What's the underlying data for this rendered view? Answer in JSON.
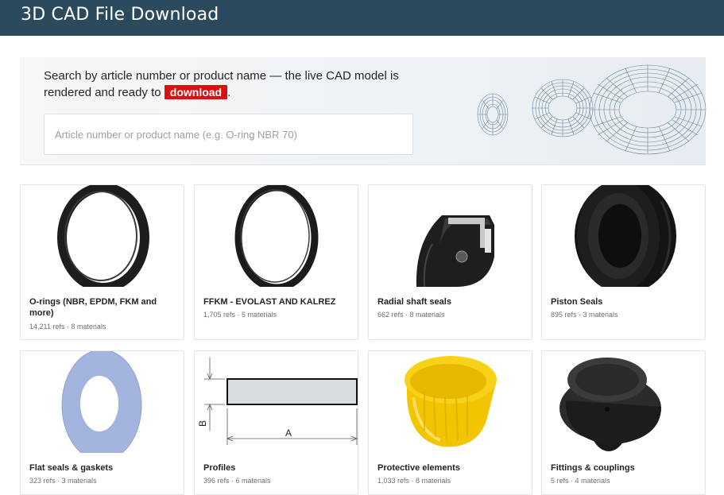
{
  "header": {
    "title": "3D CAD File Download"
  },
  "hero": {
    "intro": "Search by article number or product name — the live CAD model is rendered and ready to",
    "badge": "download",
    "suffix": ".",
    "search_placeholder": "Article number or product name (e.g. O-ring NBR 70)",
    "search_value": ""
  },
  "categories": [
    {
      "title": "O-rings (NBR, EPDM, FKM and more)",
      "meta": "14,211 refs · 8 materials",
      "icon": "o-ring-image"
    },
    {
      "title": "FFKM - EVOLAST AND KALREZ",
      "meta": "1,705 refs · 5 materials",
      "icon": "ffkm-ring-image"
    },
    {
      "title": "Radial shaft seals",
      "meta": "662 refs · 8 materials",
      "icon": "radial-shaft-seal-image"
    },
    {
      "title": "Piston Seals",
      "meta": "895 refs · 3 materials",
      "icon": "piston-seal-image"
    },
    {
      "title": "Flat seals & gaskets",
      "meta": "323 refs · 3 materials",
      "icon": "flat-gasket-image"
    },
    {
      "title": "Profiles",
      "meta": "396 refs · 6 materials",
      "icon": "profile-drawing-image"
    },
    {
      "title": "Protective elements",
      "meta": "1,033 refs · 8 materials",
      "icon": "protective-cap-image"
    },
    {
      "title": "Fittings & couplings",
      "meta": "5 refs · 4 materials",
      "icon": "coupling-image"
    }
  ],
  "profile_drawing": {
    "label_a": "A",
    "label_b": "B"
  },
  "colors": {
    "header_bg": "#2c4a5e",
    "badge_bg": "#d9120f",
    "ring_wire": "#5c7a94"
  }
}
